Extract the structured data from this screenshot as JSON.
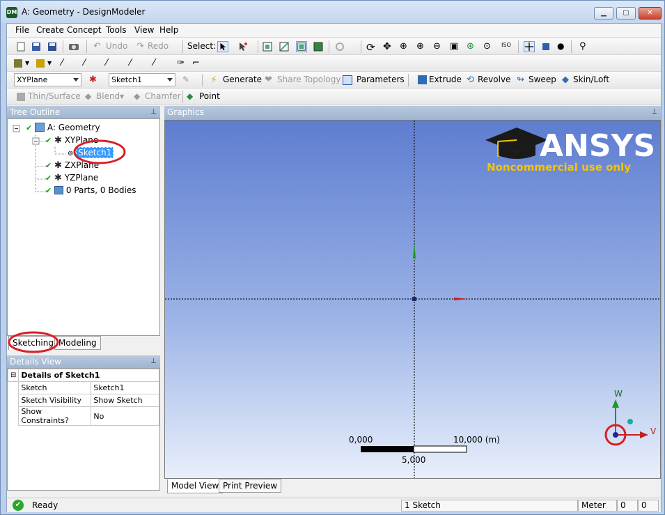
{
  "window": {
    "title": "A: Geometry - DesignModeler",
    "app_icon_text": "DM"
  },
  "menu": [
    "File",
    "Create",
    "Concept",
    "Tools",
    "View",
    "Help"
  ],
  "toolbar1": {
    "undo_label": "Undo",
    "redo_label": "Redo",
    "select_label": "Select:",
    "iso_label": "ISO"
  },
  "toolbar3": {
    "plane_combo": "XYPlane",
    "sketch_combo": "Sketch1",
    "generate": "Generate",
    "share_topology": "Share Topology",
    "parameters": "Parameters",
    "extrude": "Extrude",
    "revolve": "Revolve",
    "sweep": "Sweep",
    "skinloft": "Skin/Loft"
  },
  "toolbar4": {
    "thin_surface": "Thin/Surface",
    "blend": "Blend",
    "chamfer": "Chamfer",
    "point": "Point"
  },
  "tree_outline": {
    "title": "Tree Outline",
    "items": [
      {
        "label": "A: Geometry"
      },
      {
        "label": "XYPlane"
      },
      {
        "label": "Sketch1"
      },
      {
        "label": "ZXPlane"
      },
      {
        "label": "YZPlane"
      },
      {
        "label": "0 Parts, 0 Bodies"
      }
    ]
  },
  "tabs": {
    "sketching": "Sketching",
    "modeling": "Modeling"
  },
  "details": {
    "title": "Details View",
    "section": "Details of Sketch1",
    "rows": [
      {
        "key": "Sketch",
        "value": "Sketch1"
      },
      {
        "key": "Sketch Visibility",
        "value": "Show Sketch"
      },
      {
        "key": "Show Constraints?",
        "value": "No"
      }
    ]
  },
  "graphics": {
    "title": "Graphics",
    "logo_text": "ANSYS",
    "noncommercial": "Noncommercial use only",
    "scale_left": "0,000",
    "scale_right": "10,000 (m)",
    "scale_mid": "5,000",
    "axis_w": "W",
    "axis_v": "V"
  },
  "graphics_tabs": {
    "model_view": "Model View",
    "print_preview": "Print Preview"
  },
  "status": {
    "ready": "Ready",
    "selection": "1 Sketch",
    "units": "Meter",
    "v1": "0",
    "v2": "0"
  },
  "colors": {
    "highlight_circle": "#d81f26",
    "logo_gold": "#f5c400"
  }
}
